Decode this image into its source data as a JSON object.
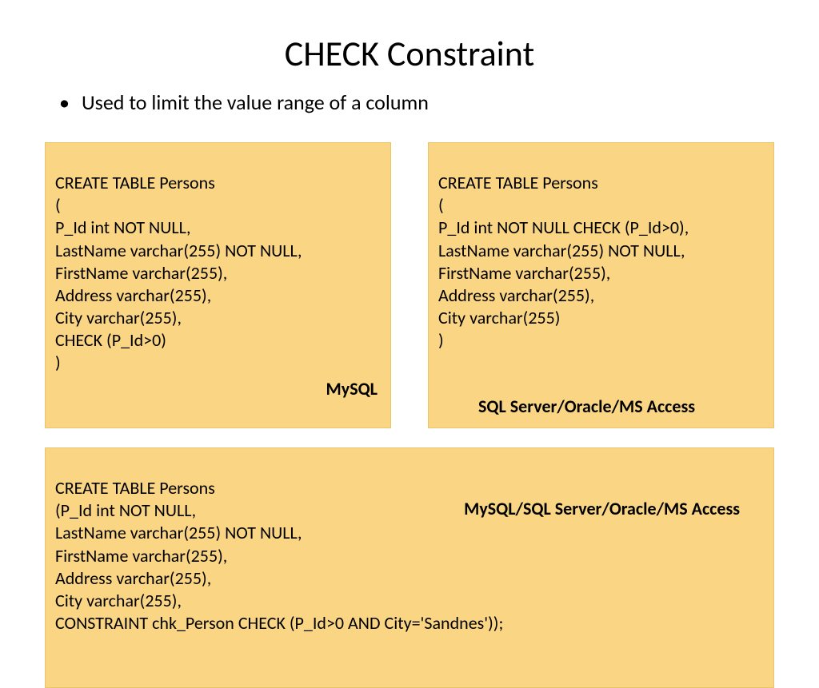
{
  "title": "CHECK Constraint",
  "bullet": "Used to limit the value range of a column",
  "box1": {
    "code": "CREATE TABLE Persons\n(\nP_Id int NOT NULL,\nLastName varchar(255) NOT NULL,\nFirstName varchar(255),\nAddress varchar(255),\nCity varchar(255),\nCHECK (P_Id>0)\n)",
    "label": "MySQL"
  },
  "box2": {
    "code": "CREATE TABLE Persons\n(\nP_Id int NOT NULL CHECK (P_Id>0),\nLastName varchar(255) NOT NULL,\nFirstName varchar(255),\nAddress varchar(255),\nCity varchar(255)\n)",
    "label": "SQL Server/Oracle/MS Access"
  },
  "box3": {
    "code": "CREATE TABLE Persons\n(P_Id int NOT NULL,\nLastName varchar(255) NOT NULL,\nFirstName varchar(255),\nAddress varchar(255),\nCity varchar(255),\nCONSTRAINT chk_Person CHECK (P_Id>0 AND City='Sandnes'));",
    "label": "MySQL/SQL Server/Oracle/MS Access"
  }
}
